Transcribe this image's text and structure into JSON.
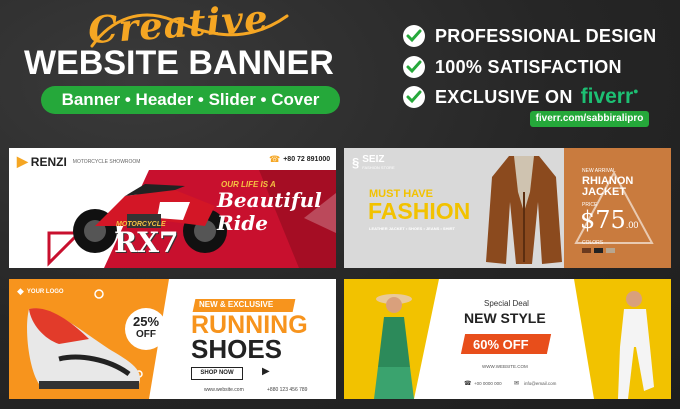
{
  "header": {
    "script_word": "Creative",
    "main_title": "WEBSITE BANNER",
    "tags": "Banner • Header • Slider • Cover"
  },
  "features": [
    {
      "text": "PROFESSIONAL DESIGN"
    },
    {
      "text": "100% SATISFACTION"
    },
    {
      "text": "EXCLUSIVE ON"
    }
  ],
  "fiverr": {
    "logo": "fiverr",
    "url": "fiverr.com/sabbiralipro"
  },
  "colors": {
    "green": "#25a83a",
    "orange": "#f5a623",
    "red": "#c8102e",
    "brown": "#c97b3e",
    "yellow": "#f2c200"
  },
  "banner1": {
    "brand": "RENZI",
    "brand_sub": "MOTORCYCLE SHOWROOM",
    "phone": "+80 72 891000",
    "tagline": "OUR LIFE IS A",
    "headline1": "Beautiful",
    "headline2": "Ride",
    "model_top": "MOTORCYCLE",
    "model": "RX7"
  },
  "banner2": {
    "brand": "SEIZ",
    "brand_sub": "FASHION STORE",
    "must_have": "MUST HAVE",
    "fashion": "FASHION",
    "cats": "LEATHER JACKET • SHOES • JEANS • SHIRT",
    "new_arrival": "NEW ARRIVAL",
    "product": "RHIANON",
    "product2": "JACKET",
    "price_label": "PRICE",
    "price": "$75",
    "price_cents": ".00",
    "colors_label": "COLORS"
  },
  "banner3": {
    "logo": "YOUR LOGO",
    "discount": "25%",
    "off": "OFF",
    "badge": "NEW & EXCLUSIVE",
    "line1": "RUNNING",
    "line2": "SHOES",
    "cta": "SHOP NOW",
    "site": "www.website.com",
    "phone": "+880 123 456 789"
  },
  "banner4": {
    "special": "Special Deal",
    "headline": "NEW STYLE",
    "deal": "60% OFF",
    "site": "WWW.WEBSITE.COM",
    "phone": "+00 0000 000",
    "email": "info@email.com"
  }
}
